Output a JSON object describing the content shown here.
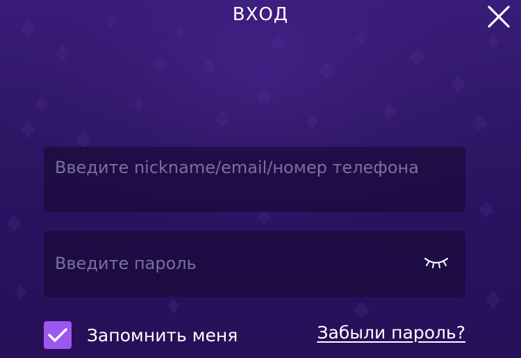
{
  "header": {
    "title": "ВХОД",
    "close_icon": "close-icon"
  },
  "login_field": {
    "placeholder": "Введите nickname/email/номер телефона"
  },
  "password_field": {
    "placeholder": "Введите пароль",
    "toggle_icon": "eye-closed-icon"
  },
  "remember": {
    "label": "Запомнить меня",
    "checked": true
  },
  "forgot": {
    "label": "Забыли пароль?"
  },
  "colors": {
    "background": "#2f1766",
    "field_bg": "#1f0e40",
    "placeholder": "#7d6f9c",
    "checkbox": "#9b57ef",
    "text": "#ffffff"
  }
}
